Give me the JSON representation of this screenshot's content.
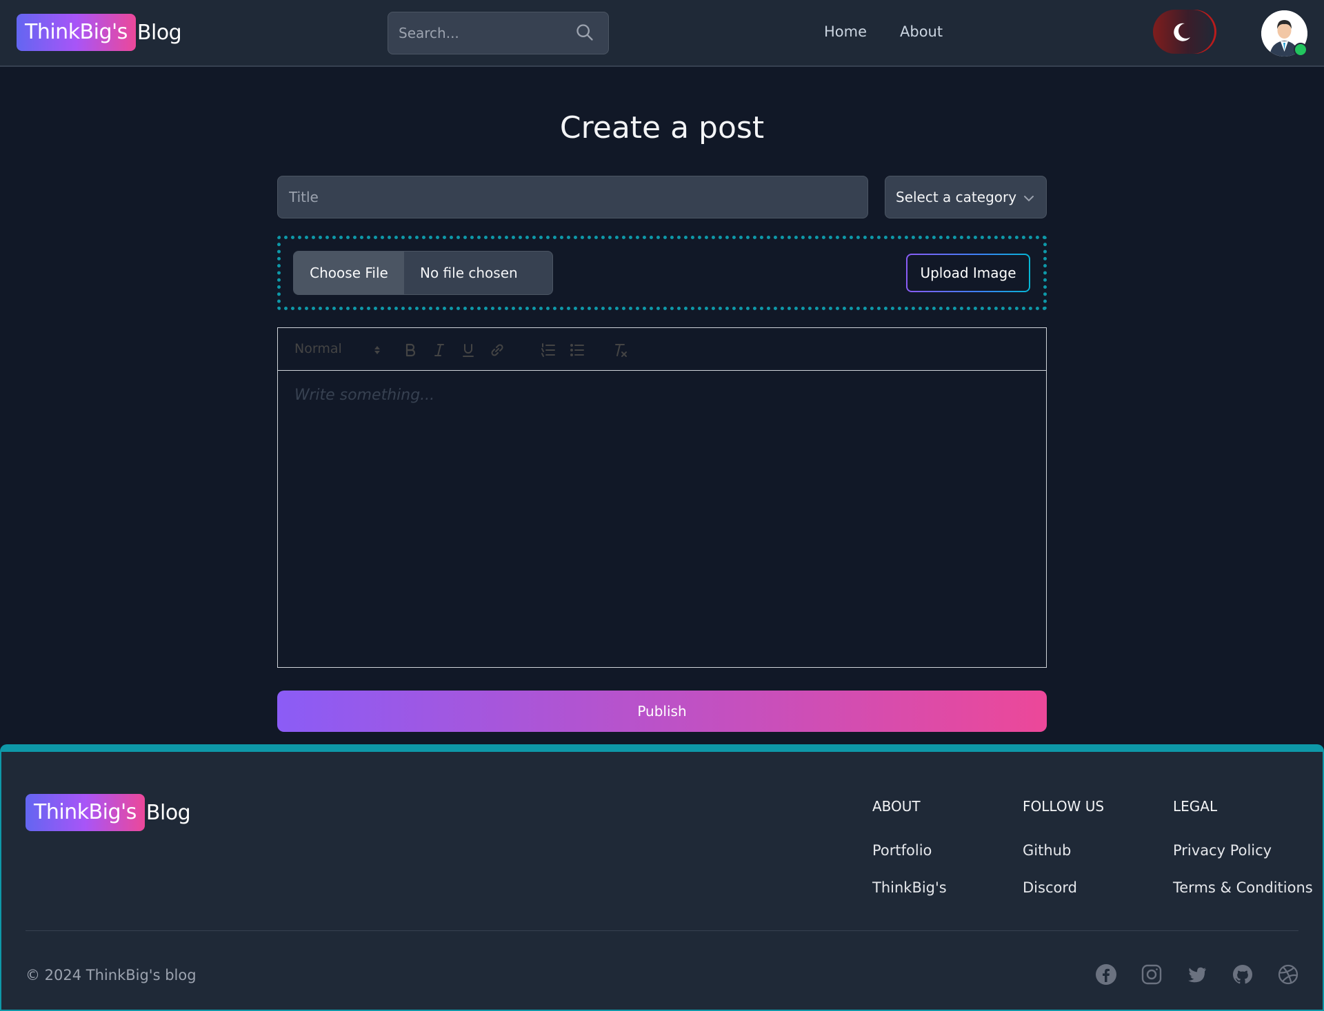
{
  "navbar": {
    "brand_badge": "ThinkBig's",
    "brand_rest": "Blog",
    "search_placeholder": "Search...",
    "links": [
      "Home",
      "About"
    ]
  },
  "main": {
    "page_title": "Create a post",
    "title_placeholder": "Title",
    "category_label": "Select a category",
    "file_button": "Choose File",
    "file_status": "No file chosen",
    "upload_button": "Upload Image",
    "toolbar_format": "Normal",
    "editor_placeholder": "Write something...",
    "publish_button": "Publish"
  },
  "footer": {
    "brand_badge": "ThinkBig's",
    "brand_rest": "Blog",
    "columns": [
      {
        "title": "ABOUT",
        "links": [
          "Portfolio",
          "ThinkBig's"
        ]
      },
      {
        "title": "FOLLOW US",
        "links": [
          "Github",
          "Discord"
        ]
      },
      {
        "title": "LEGAL",
        "links": [
          "Privacy Policy",
          "Terms & Conditions"
        ]
      }
    ],
    "copyright": "© 2024 ThinkBig's blog",
    "social_icons": [
      "facebook-icon",
      "instagram-icon",
      "twitter-icon",
      "github-icon",
      "dribbble-icon"
    ]
  },
  "colors": {
    "background": "#111827",
    "surface": "#1f2937",
    "accent_teal": "#0e98a8",
    "gradient_start": "#8b5cf6",
    "gradient_end": "#ec4899"
  }
}
